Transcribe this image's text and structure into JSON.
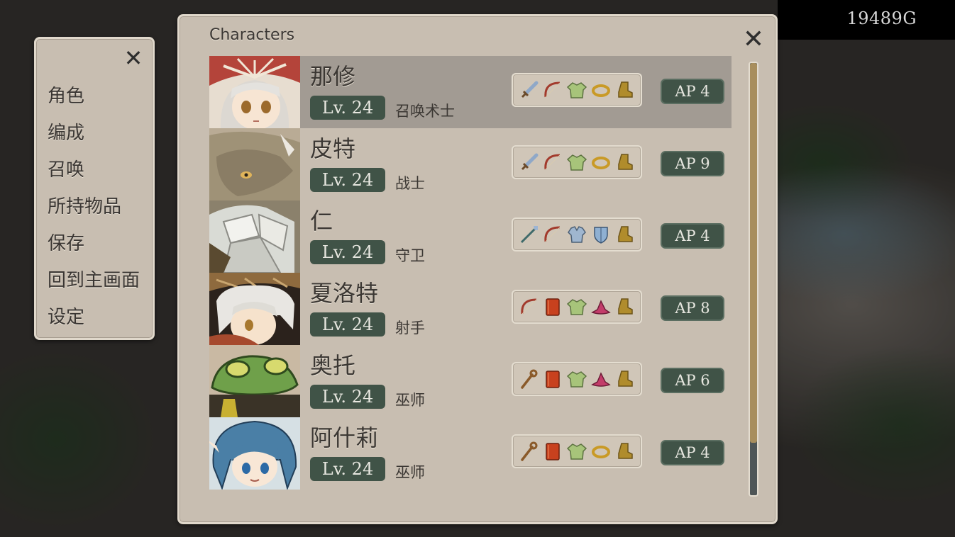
{
  "currency": {
    "gold": "19489G"
  },
  "side_menu": {
    "items": [
      {
        "label": "角色"
      },
      {
        "label": "编成"
      },
      {
        "label": "召唤"
      },
      {
        "label": "所持物品"
      },
      {
        "label": "保存"
      },
      {
        "label": "回到主画面"
      },
      {
        "label": "设定"
      }
    ]
  },
  "main": {
    "title": "Characters",
    "characters": [
      {
        "name": "那修",
        "level": "Lv. 24",
        "class": "召唤术士",
        "ap": "AP 4",
        "selected": true,
        "equipment": [
          "sword-icon",
          "bow-icon",
          "tunic-icon",
          "ring-icon",
          "boots-icon"
        ]
      },
      {
        "name": "皮特",
        "level": "Lv. 24",
        "class": "战士",
        "ap": "AP 9",
        "selected": false,
        "equipment": [
          "sword-icon",
          "bow-icon",
          "tunic-icon",
          "ring-icon",
          "boots-icon"
        ]
      },
      {
        "name": "仁",
        "level": "Lv. 24",
        "class": "守卫",
        "ap": "AP 4",
        "selected": false,
        "equipment": [
          "spear-icon",
          "bow-icon",
          "armor-icon",
          "shield-icon",
          "boots-icon"
        ]
      },
      {
        "name": "夏洛特",
        "level": "Lv. 24",
        "class": "射手",
        "ap": "AP 8",
        "selected": false,
        "equipment": [
          "bow-icon",
          "book-icon",
          "tunic-icon",
          "hat-icon",
          "boots-icon"
        ]
      },
      {
        "name": "奥托",
        "level": "Lv. 24",
        "class": "巫师",
        "ap": "AP 6",
        "selected": false,
        "equipment": [
          "staff-icon",
          "book-icon",
          "tunic-icon",
          "hat-icon",
          "boots-icon"
        ]
      },
      {
        "name": "阿什莉",
        "level": "Lv. 24",
        "class": "巫师",
        "ap": "AP 4",
        "selected": false,
        "equipment": [
          "staff-icon",
          "book-icon",
          "tunic-icon",
          "ring-icon",
          "boots-icon"
        ]
      }
    ],
    "scroll_position": 0.0,
    "scroll_visible_fraction": 0.87
  },
  "colors": {
    "panel": "#c8beb1",
    "badge": "#405347",
    "selected_row": "#a29b93"
  }
}
